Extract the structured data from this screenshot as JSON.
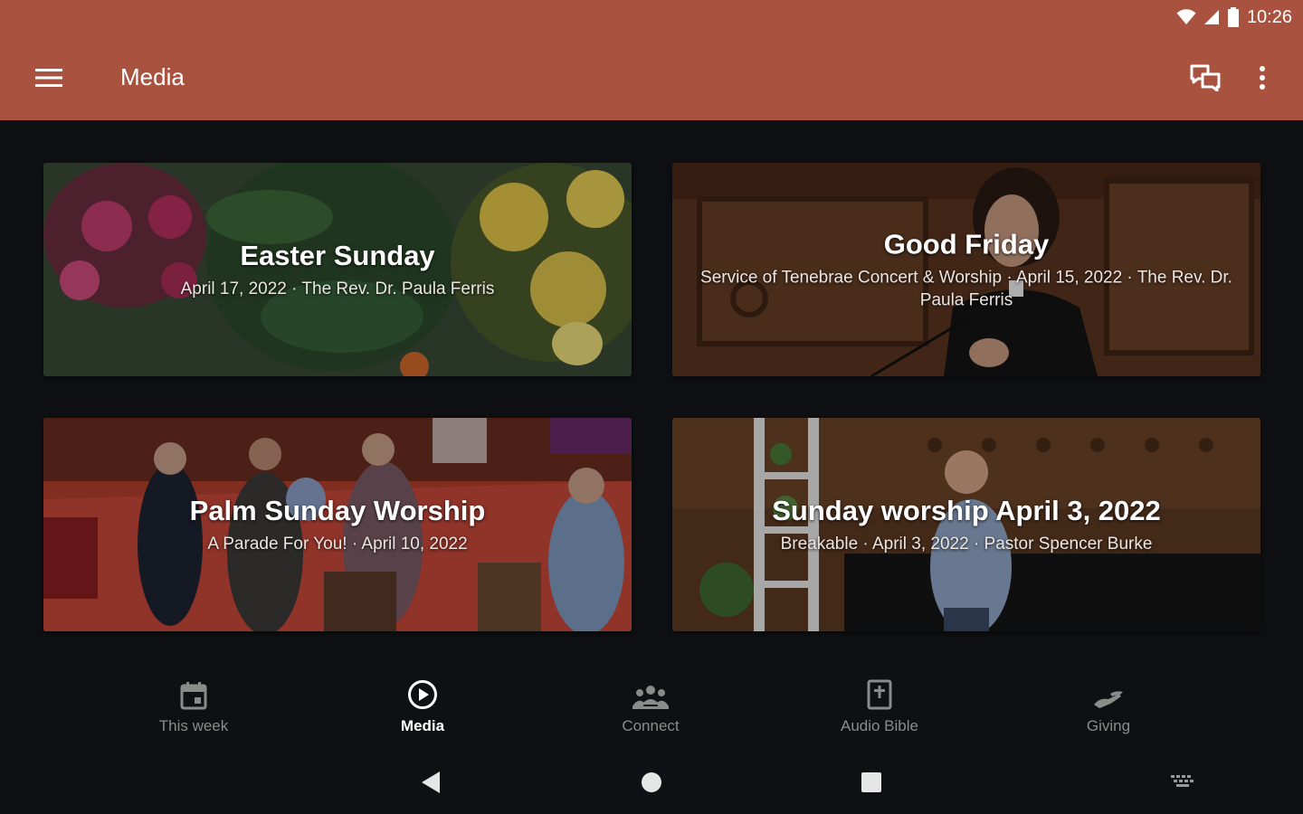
{
  "status_bar": {
    "time": "10:26",
    "icons": [
      "wifi-icon",
      "signal-icon",
      "battery-icon"
    ]
  },
  "app_bar": {
    "title": "Media",
    "icons": [
      "menu-icon",
      "chat-icon",
      "more-vert-icon"
    ]
  },
  "colors": {
    "brand": "#a9523f",
    "background": "#0f1013",
    "inactive_nav": "#8b8b8b",
    "active_nav": "#ffffff"
  },
  "media": [
    {
      "title": "Easter Sunday",
      "subtitle": "April 17, 2022 · The Rev. Dr. Paula Ferris"
    },
    {
      "title": "Good Friday",
      "subtitle": "Service of Tenebrae Concert & Worship · April 15, 2022 · The Rev. Dr. Paula Ferris"
    },
    {
      "title": "Palm Sunday Worship",
      "subtitle": "A Parade For You! · April 10, 2022"
    },
    {
      "title": "Sunday worship April 3, 2022",
      "subtitle": "Breakable · April 3, 2022 · Pastor Spencer Burke"
    }
  ],
  "bottom_nav": {
    "active": "Media",
    "items": [
      {
        "label": "This week",
        "icon": "calendar-icon"
      },
      {
        "label": "Media",
        "icon": "play-circle-icon"
      },
      {
        "label": "Connect",
        "icon": "group-icon"
      },
      {
        "label": "Audio Bible",
        "icon": "bible-icon"
      },
      {
        "label": "Giving",
        "icon": "giving-hand-icon"
      }
    ]
  },
  "system_nav": [
    "back-icon",
    "home-icon",
    "recents-icon",
    "keyboard-icon"
  ]
}
